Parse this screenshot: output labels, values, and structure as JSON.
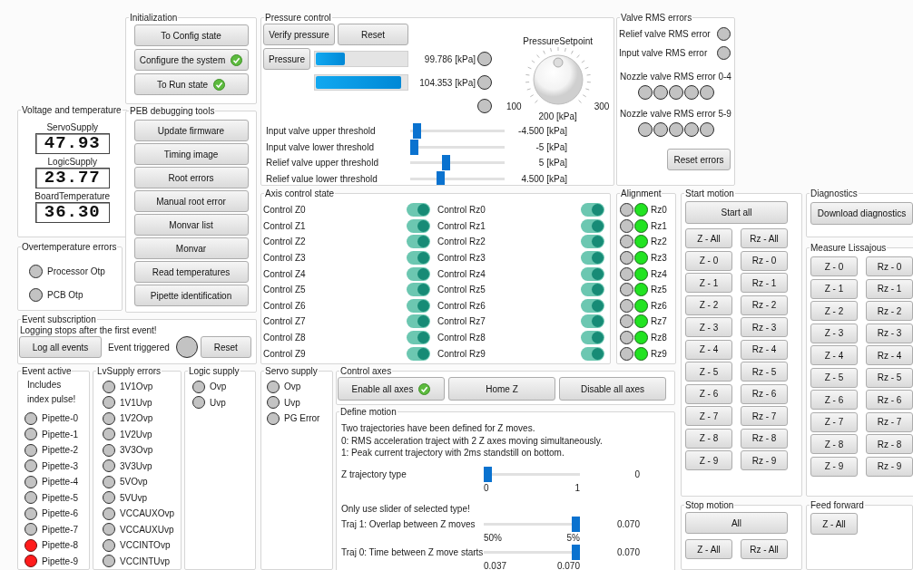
{
  "initialization": {
    "title": "Initialization",
    "buttons": [
      {
        "label": "To Config state",
        "done": false
      },
      {
        "label": "Configure the system",
        "done": true
      },
      {
        "label": "To Run state",
        "done": true
      }
    ]
  },
  "voltage_and_temperature": {
    "title": "Voltage and temperature",
    "readings": [
      {
        "label": "ServoSupply",
        "value": "47.93"
      },
      {
        "label": "LogicSupply",
        "value": "23.77"
      },
      {
        "label": "BoardTemperature",
        "value": "36.30"
      }
    ]
  },
  "overtemperature_errors": {
    "title": "Overtemperature errors",
    "indicators": [
      {
        "label": "Processor Otp",
        "active": false
      },
      {
        "label": "PCB Otp",
        "active": false
      }
    ]
  },
  "peb_debugging_tools": {
    "title": "PEB debugging tools",
    "buttons": [
      "Update firmware",
      "Timing image",
      "Root errors",
      "Manual root error",
      "Monvar list",
      "Monvar",
      "Read temperatures",
      "Pipette identification"
    ]
  },
  "event_subscription": {
    "title": "Event subscription",
    "note": "Logging stops after the first event!",
    "log_button": "Log all events",
    "indicator_label": "Event triggered",
    "triggered": false,
    "reset_button": "Reset"
  },
  "event_active": {
    "title": "Event active",
    "note": "Includes index pulse!",
    "indicators": [
      {
        "label": "Pipette-0",
        "active": false
      },
      {
        "label": "Pipette-1",
        "active": false
      },
      {
        "label": "Pipette-2",
        "active": false
      },
      {
        "label": "Pipette-3",
        "active": false
      },
      {
        "label": "Pipette-4",
        "active": false
      },
      {
        "label": "Pipette-5",
        "active": false
      },
      {
        "label": "Pipette-6",
        "active": false
      },
      {
        "label": "Pipette-7",
        "active": false
      },
      {
        "label": "Pipette-8",
        "active": true
      },
      {
        "label": "Pipette-9",
        "active": true
      }
    ]
  },
  "lvsupply_errors": {
    "title": "LvSupply errors",
    "indicators": [
      {
        "label": "1V1Ovp",
        "active": false
      },
      {
        "label": "1V1Uvp",
        "active": false
      },
      {
        "label": "1V2Ovp",
        "active": false
      },
      {
        "label": "1V2Uvp",
        "active": false
      },
      {
        "label": "3V3Ovp",
        "active": false
      },
      {
        "label": "3V3Uvp",
        "active": false
      },
      {
        "label": "5VOvp",
        "active": false
      },
      {
        "label": "5VUvp",
        "active": false
      },
      {
        "label": "VCCAUXOvp",
        "active": false
      },
      {
        "label": "VCCAUXUvp",
        "active": false
      },
      {
        "label": "VCCINTOvp",
        "active": false
      },
      {
        "label": "VCCINTUvp",
        "active": false
      }
    ]
  },
  "logic_supply": {
    "title": "Logic supply",
    "indicators": [
      {
        "label": "Ovp",
        "active": false
      },
      {
        "label": "Uvp",
        "active": false
      }
    ]
  },
  "pressure_control": {
    "title": "Pressure control",
    "buttons": [
      "Verify pressure",
      "Reset"
    ],
    "pressure_button": "Pressure",
    "gauges": [
      {
        "level": 0.32,
        "reading": "99.786 [kPa]"
      },
      {
        "level": 0.94,
        "reading": "104.353 [kPa]"
      }
    ],
    "indicators": [
      {
        "active": false
      },
      {
        "active": false
      },
      {
        "active": false
      }
    ],
    "setpoint": {
      "label": "PressureSetpoint",
      "min": "100",
      "max": "300",
      "reading": "200 [kPa]"
    },
    "thresholds": [
      {
        "label": "Input valve upper threshold",
        "level": 0.03,
        "reading": "-4.500 [kPa]"
      },
      {
        "label": "Input valve lower threshold",
        "level": 0.0,
        "reading": "-5 [kPa]"
      },
      {
        "label": "Relief valve upper threshold",
        "level": 0.37,
        "reading": "5 [kPa]"
      },
      {
        "label": "Relief value lower threshold",
        "level": 0.31,
        "reading": "4.500 [kPa]"
      }
    ]
  },
  "valve_rms_errors": {
    "title": "Valve RMS errors",
    "indicators": [
      {
        "label": "Relief valve RMS error",
        "active": false
      },
      {
        "label": "Input valve RMS error",
        "active": false
      }
    ],
    "nozzle_groups": [
      {
        "label": "Nozzle valve RMS error 0-4",
        "states": [
          false,
          false,
          false,
          false,
          false
        ]
      },
      {
        "label": "Nozzle valve RMS error 5-9",
        "states": [
          false,
          false,
          false,
          false,
          false
        ]
      }
    ],
    "reset_button": "Reset errors"
  },
  "axis_control_state": {
    "title": "Axis control state",
    "z_axes": [
      {
        "label": "Control Z0",
        "on": true
      },
      {
        "label": "Control Z1",
        "on": true
      },
      {
        "label": "Control Z2",
        "on": true
      },
      {
        "label": "Control Z3",
        "on": true
      },
      {
        "label": "Control Z4",
        "on": true
      },
      {
        "label": "Control Z5",
        "on": true
      },
      {
        "label": "Control Z6",
        "on": true
      },
      {
        "label": "Control Z7",
        "on": true
      },
      {
        "label": "Control Z8",
        "on": true
      },
      {
        "label": "Control Z9",
        "on": true
      }
    ],
    "rz_axes": [
      {
        "label": "Control Rz0",
        "on": true
      },
      {
        "label": "Control Rz1",
        "on": true
      },
      {
        "label": "Control Rz2",
        "on": true
      },
      {
        "label": "Control Rz3",
        "on": true
      },
      {
        "label": "Control Rz4",
        "on": true
      },
      {
        "label": "Control Rz5",
        "on": true
      },
      {
        "label": "Control Rz6",
        "on": true
      },
      {
        "label": "Control Rz7",
        "on": true
      },
      {
        "label": "Control Rz8",
        "on": true
      },
      {
        "label": "Control Rz9",
        "on": true
      }
    ]
  },
  "alignment": {
    "title": "Alignment",
    "rows": [
      {
        "label": "Rz0",
        "states": [
          false,
          true
        ]
      },
      {
        "label": "Rz1",
        "states": [
          false,
          true
        ]
      },
      {
        "label": "Rz2",
        "states": [
          false,
          true
        ]
      },
      {
        "label": "Rz3",
        "states": [
          false,
          true
        ]
      },
      {
        "label": "Rz4",
        "states": [
          false,
          true
        ]
      },
      {
        "label": "Rz5",
        "states": [
          false,
          true
        ]
      },
      {
        "label": "Rz6",
        "states": [
          false,
          true
        ]
      },
      {
        "label": "Rz7",
        "states": [
          false,
          true
        ]
      },
      {
        "label": "Rz8",
        "states": [
          false,
          true
        ]
      },
      {
        "label": "Rz9",
        "states": [
          false,
          true
        ]
      }
    ]
  },
  "start_motion": {
    "title": "Start motion",
    "start_all": "Start all",
    "rows": [
      {
        "z": "Z - All",
        "rz": "Rz - All"
      },
      {
        "z": "Z - 0",
        "rz": "Rz - 0"
      },
      {
        "z": "Z - 1",
        "rz": "Rz - 1"
      },
      {
        "z": "Z - 2",
        "rz": "Rz - 2"
      },
      {
        "z": "Z - 3",
        "rz": "Rz - 3"
      },
      {
        "z": "Z - 4",
        "rz": "Rz - 4"
      },
      {
        "z": "Z - 5",
        "rz": "Rz - 5"
      },
      {
        "z": "Z - 6",
        "rz": "Rz - 6"
      },
      {
        "z": "Z - 7",
        "rz": "Rz - 7"
      },
      {
        "z": "Z - 8",
        "rz": "Rz - 8"
      },
      {
        "z": "Z - 9",
        "rz": "Rz - 9"
      }
    ]
  },
  "diagnostics": {
    "title": "Diagnostics",
    "button": "Download diagnostics"
  },
  "measure_lissajous": {
    "title": "Measure Lissajous",
    "rows": [
      {
        "z": "Z - 0",
        "rz": "Rz - 0"
      },
      {
        "z": "Z - 1",
        "rz": "Rz - 1"
      },
      {
        "z": "Z - 2",
        "rz": "Rz - 2"
      },
      {
        "z": "Z - 3",
        "rz": "Rz - 3"
      },
      {
        "z": "Z - 4",
        "rz": "Rz - 4"
      },
      {
        "z": "Z - 5",
        "rz": "Rz - 5"
      },
      {
        "z": "Z - 6",
        "rz": "Rz - 6"
      },
      {
        "z": "Z - 7",
        "rz": "Rz - 7"
      },
      {
        "z": "Z - 8",
        "rz": "Rz - 8"
      },
      {
        "z": "Z - 9",
        "rz": "Rz - 9"
      }
    ]
  },
  "servo_supply": {
    "title": "Servo supply",
    "indicators": [
      {
        "label": "Ovp",
        "active": false
      },
      {
        "label": "Uvp",
        "active": false
      },
      {
        "label": "PG Error",
        "active": false
      }
    ]
  },
  "control_axes": {
    "title": "Control axes",
    "buttons": [
      {
        "label": "Enable all axes",
        "done": true
      },
      {
        "label": "Home Z",
        "done": false
      },
      {
        "label": "Disable all axes",
        "done": false
      }
    ]
  },
  "define_motion": {
    "title": "Define motion",
    "description": [
      "Two trajectories have been defined for Z moves.",
      "0: RMS acceleration traject with 2 Z axes moving simultaneously.",
      "1: Peak current trajectory with 2ms standstill on bottom."
    ],
    "trajectory_type": {
      "label": "Z trajectory type",
      "level": 0,
      "min": "0",
      "max": "1",
      "reading": "0"
    },
    "note": "Only use slider of selected type!",
    "sliders": [
      {
        "label": "Traj 1: Overlap between Z moves",
        "level": 1,
        "min": "50%",
        "max": "5%",
        "reading": "0.070"
      },
      {
        "label": "Traj 0: Time between Z move starts",
        "level": 1,
        "min": "0.037",
        "max": "0.070",
        "reading": "0.070"
      }
    ]
  },
  "stop_motion": {
    "title": "Stop motion",
    "all_button": "All",
    "buttons": [
      "Z - All",
      "Rz - All"
    ]
  },
  "feed_forward": {
    "title": "Feed forward",
    "button": "Z - All"
  }
}
